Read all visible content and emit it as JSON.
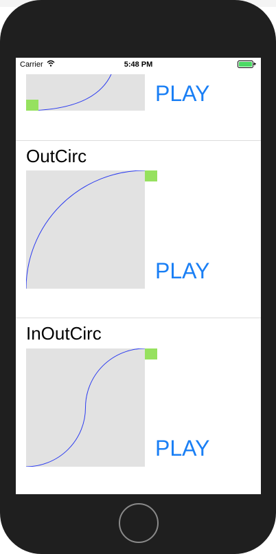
{
  "status_bar": {
    "carrier": "Carrier",
    "time": "5:48 PM"
  },
  "sections": [
    {
      "title": "",
      "play_label": "PLAY"
    },
    {
      "title": "OutCirc",
      "play_label": "PLAY"
    },
    {
      "title": "InOutCirc",
      "play_label": "PLAY"
    }
  ],
  "colors": {
    "accent": "#1a7ff5",
    "curve": "#2b3bf0",
    "marker": "#96e15f",
    "plot_bg": "#e2e2e2"
  }
}
